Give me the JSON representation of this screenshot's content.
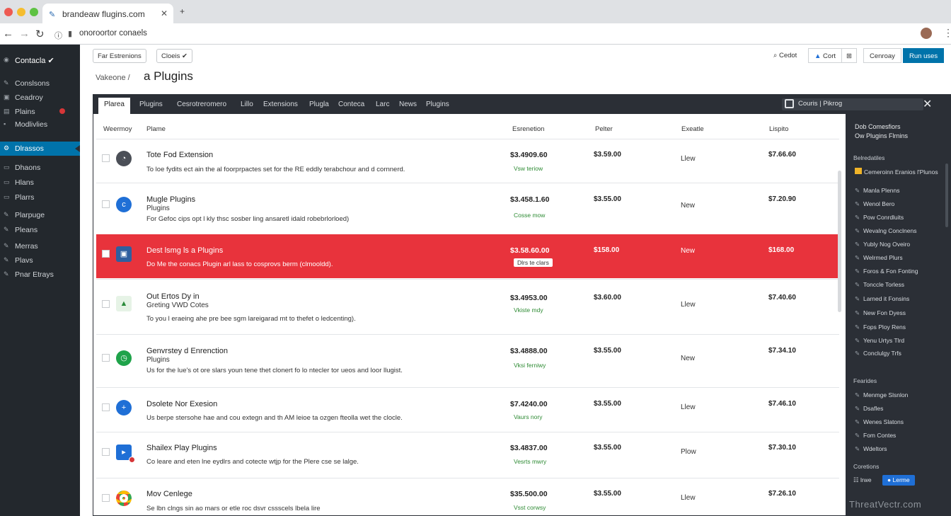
{
  "browser": {
    "tab_title": "brandeaw flugins.com",
    "new_tab": "+",
    "url": "onoroortor conaels"
  },
  "sidebar": {
    "items": [
      {
        "label": "Contacla ✔",
        "icon": "dashboard-icon"
      },
      {
        "label": "Conslsons",
        "icon": "pin-icon"
      },
      {
        "label": "Ceadroy",
        "icon": "media-icon"
      },
      {
        "label": "Plains",
        "icon": "pages-icon"
      },
      {
        "label": "Modlivlies",
        "icon": "comments-icon"
      },
      {
        "label": "Dlrassos",
        "icon": "plugins-icon"
      },
      {
        "label": "Dhaons",
        "icon": "users-icon"
      },
      {
        "label": "Hlans",
        "icon": "tools-icon"
      },
      {
        "label": "Plarrs",
        "icon": "settings-icon"
      },
      {
        "label": "Plarpuge",
        "icon": "brush-icon"
      },
      {
        "label": "Pleans",
        "icon": "pin-icon"
      },
      {
        "label": "Merras",
        "icon": "pin-icon"
      },
      {
        "label": "Plavs",
        "icon": "pin-icon"
      },
      {
        "label": "Pnar Etrays",
        "icon": "pin-icon"
      }
    ]
  },
  "toolbar": {
    "left_buttons": [
      "Far Estrenions",
      "Cloeis ✔"
    ],
    "breadcrumb": "Vakeone  /",
    "page_title": "a Plugins",
    "right_buttons": [
      "Cedot",
      "Cort",
      "Cenroay",
      "Run uses"
    ],
    "primary_label": "Run uses",
    "accent": "#0073aa"
  },
  "panel": {
    "tabs": [
      "Plarea",
      "Plugins",
      "Cesrotreromero",
      "Lillo",
      "Extensions",
      "Plugla",
      "Conteca",
      "Larc",
      "News",
      "Plugins"
    ],
    "filter": "Couris | Pikrog",
    "columns": [
      "Weermoy",
      "Plame",
      "Esrenetion",
      "Pelter",
      "Exeatle",
      "Lispito"
    ],
    "rows": [
      {
        "name": "Tote Fod Extension",
        "sub": "",
        "desc": "To loe fydits ect ain the al foorprpactes set for the RE eddly terabchour and d cornnerd.",
        "price": "$3.4909.60",
        "link": "Vsw teriow",
        "rate": "$3.59.00",
        "status": "Llew",
        "total": "$7.66.60",
        "icon": "chat-icon",
        "color": "#4b4f57"
      },
      {
        "name": "Mugle Plugins",
        "sub": "Plugins",
        "desc": "For Gefoc cips opt l kly thsc sosber ling ansaretl idald robebrlorloed)",
        "price": "$3.458.1.60",
        "link": "Cosse mow",
        "rate": "$3.55.00",
        "status": "New",
        "total": "$7.20.90",
        "icon": "c-icon",
        "color": "#1f6fd6"
      },
      {
        "name": "Dest lsmg ls a Plugins",
        "sub": "",
        "desc": "Do Me the conacs Plugin arl lass to cosprovs berm (clmooldd).",
        "price": "$3.58.60.00",
        "link": "Dlrs te clars",
        "rate": "$158.00",
        "status": "New",
        "total": "$168.00",
        "icon": "image-icon",
        "color": "#2f5f9f",
        "highlight": true
      },
      {
        "name": "Out Ertos Dy in",
        "sub": "Greting VWD Cotes",
        "desc": "To you l eraeing ahe pre bee sgm lareigarad mt to thefet o ledcenting).",
        "price": "$3.4953.00",
        "link": "Vkiste mdy",
        "rate": "$3.60.00",
        "status": "Llew",
        "total": "$7.40.60",
        "icon": "landscape-icon",
        "color": "#e6f3e6"
      },
      {
        "name": "Genvrstey d Enrenction",
        "sub": "Plugins",
        "desc": "Us for the lue's ot ore slars youn tene thet clonert fo lo ntecler tor ueos and loor llugist.",
        "price": "$3.4888.00",
        "link": "Vksi ferniwy",
        "rate": "$3.55.00",
        "status": "New",
        "total": "$7.34.10",
        "icon": "clock-icon",
        "color": "#1fa34a"
      },
      {
        "name": "Dsolete Nor Exesion",
        "sub": "",
        "desc": "Us berpe stersohe hae and cou extegn and th AM leioe ta ozgen fteolla wet the clocle.",
        "price": "$7.4240.00",
        "link": "Vaurs nory",
        "rate": "$3.55.00",
        "status": "Llew",
        "total": "$7.46.10",
        "icon": "plus-icon",
        "color": "#1f6fd6"
      },
      {
        "name": "Shailex Play Plugins",
        "sub": "",
        "desc": "Co leare and eten lne eydlrs and cotecte wtjp for the Plere cse se lalge.",
        "price": "$3.4837.00",
        "link": "Vesrts mwry",
        "rate": "$3.55.00",
        "status": "Plow",
        "total": "$7.30.10",
        "icon": "play-icon",
        "color": "#1f6fd6"
      },
      {
        "name": "Mov Cenlege",
        "sub": "",
        "desc": "Se lbn clngs sin ao mars or etle roc dsvr cssscels lbela lire",
        "price": "$35.500.00",
        "link": "Vsst corwsy",
        "rate": "$3.55.00",
        "status": "Llew",
        "total": "$7.26.10",
        "icon": "chrome-icon",
        "color": "#ea4335"
      }
    ]
  },
  "right_panel": {
    "intro": [
      "Dob Comesfiors",
      "Ow Plugins Flrnins"
    ],
    "section1": "Belredatiles",
    "list1": [
      "Cemeroinn Eranios l'Plunos",
      "Manla Plenns",
      "Wenol Bero",
      "Pow Conrdluits",
      "Wevalng Conclnens",
      "Yubly Nog Oveiro",
      "Welrmed Plurs",
      "Foros & Fon Fonting",
      "Tonccle Torless",
      "Larned it Fonsins",
      "New Fon Dyess",
      "Fops Ploy Rens",
      "Yenu Urtys Tlrd",
      "Conclulgy Trfs"
    ],
    "section2": "Fearides",
    "list2": [
      "Menmge Slsnlon",
      "Dsafles",
      "Wenes Slatons",
      "Fom Contes",
      "Wdeltors"
    ],
    "section3": "Coretions",
    "footer_buttons": [
      "lrwe",
      "Lerme"
    ]
  },
  "watermark": "ThreatVectr.com"
}
